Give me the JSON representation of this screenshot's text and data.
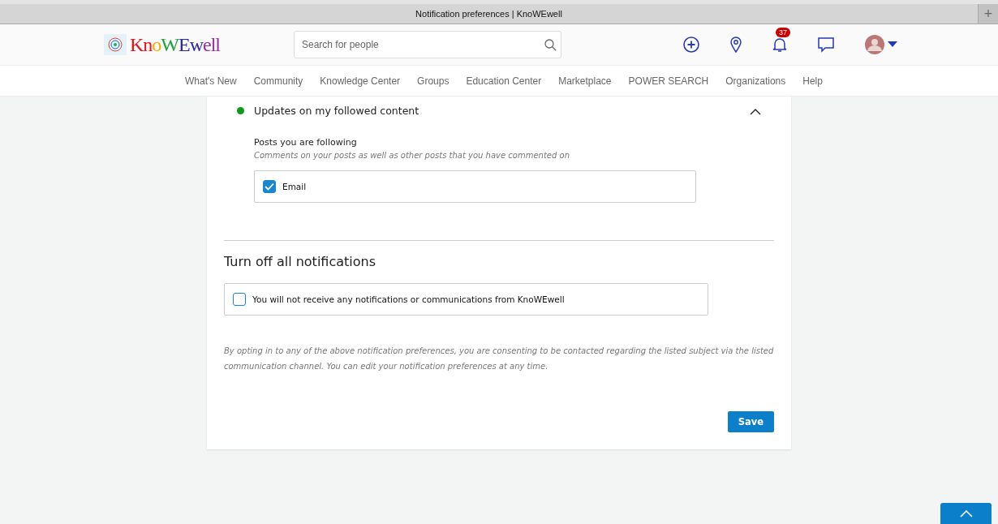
{
  "window": {
    "title": "Notification preferences | KnoWEwell",
    "new_tab": "+"
  },
  "header": {
    "logo": "KnoWEwell",
    "search": {
      "placeholder": "Search for people"
    },
    "notification_count": "37"
  },
  "nav": [
    {
      "label": "What's New"
    },
    {
      "label": "Community"
    },
    {
      "label": "Knowledge Center"
    },
    {
      "label": "Groups"
    },
    {
      "label": "Education Center"
    },
    {
      "label": "Marketplace"
    },
    {
      "label": "POWER SEARCH"
    },
    {
      "label": "Organizations"
    },
    {
      "label": "Help"
    }
  ],
  "sections": [
    {
      "title": "Updates on my followed content",
      "color": "#0c9a1c",
      "expanded": true,
      "groups": [
        {
          "title": "Posts you are following",
          "description": "Comments on your posts as well as other posts that you have commented on",
          "options": [
            {
              "label": "Email",
              "checked": true
            }
          ]
        }
      ]
    }
  ],
  "turn_off": {
    "title": "Turn off all notifications",
    "option": {
      "label": "You will not receive any notifications or communications from KnoWEwell",
      "checked": false
    }
  },
  "disclaimer": "By opting in to any of the above notification preferences, you are consenting to be contacted regarding the listed subject via the listed communication channel. You can edit your notification preferences at any time.",
  "save_button": "Save"
}
